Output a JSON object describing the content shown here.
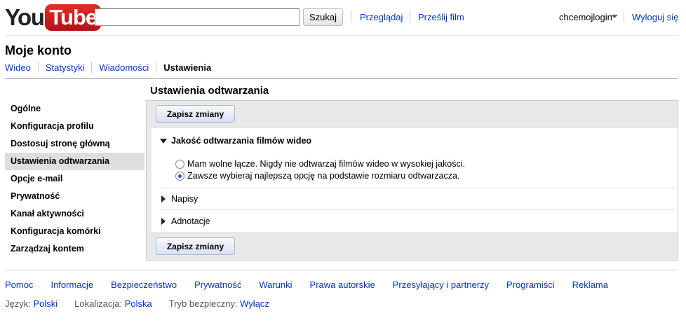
{
  "header": {
    "logo_you": "You",
    "logo_tube": "Tube",
    "search_placeholder": "",
    "search_button": "Szukaj",
    "browse_link": "Przeglądaj",
    "upload_link": "Prześlij film",
    "username": "chcemojlogin",
    "logout_link": "Wyloguj się"
  },
  "account": {
    "title": "Moje konto",
    "tabs": [
      {
        "label": "Wideo",
        "active": false
      },
      {
        "label": "Statystyki",
        "active": false
      },
      {
        "label": "Wiadomości",
        "active": false
      },
      {
        "label": "Ustawienia",
        "active": true
      }
    ]
  },
  "sidebar": {
    "items": [
      {
        "label": "Ogólne",
        "active": false
      },
      {
        "label": "Konfiguracja profilu",
        "active": false
      },
      {
        "label": "Dostosuj stronę główną",
        "active": false
      },
      {
        "label": "Ustawienia odtwarzania",
        "active": true
      },
      {
        "label": "Opcje e-mail",
        "active": false
      },
      {
        "label": "Prywatność",
        "active": false
      },
      {
        "label": "Kanał aktywności",
        "active": false
      },
      {
        "label": "Konfiguracja komórki",
        "active": false
      },
      {
        "label": "Zarządzaj kontem",
        "active": false
      }
    ]
  },
  "settings": {
    "title": "Ustawienia odtwarzania",
    "save_button": "Zapisz zmiany",
    "quality_section": {
      "label": "Jakość odtwarzania filmów wideo",
      "expanded": true,
      "options": [
        {
          "label": "Mam wolne łącze. Nigdy nie odtwarzaj filmów wideo w wysokiej jakości.",
          "checked": false
        },
        {
          "label": "Zawsze wybieraj najlepszą opcję na podstawie rozmiaru odtwarzacza.",
          "checked": true
        }
      ]
    },
    "subtitles_section": {
      "label": "Napisy",
      "expanded": false
    },
    "annotations_section": {
      "label": "Adnotacje",
      "expanded": false
    }
  },
  "footer": {
    "links": [
      "Pomoc",
      "Informacje",
      "Bezpieczeństwo",
      "Prywatność",
      "Warunki",
      "Prawa autorskie",
      "Przesyłający i partnerzy",
      "Programiści",
      "Reklama"
    ],
    "language_label": "Język:",
    "language_value": "Polski",
    "location_label": "Lokalizacja:",
    "location_value": "Polska",
    "safety_label": "Tryb bezpieczny:",
    "safety_value": "Wyłącz"
  },
  "colors": {
    "link": "#0033cc",
    "logo_red": "#cc181e",
    "active_item_bg": "#dedede"
  }
}
